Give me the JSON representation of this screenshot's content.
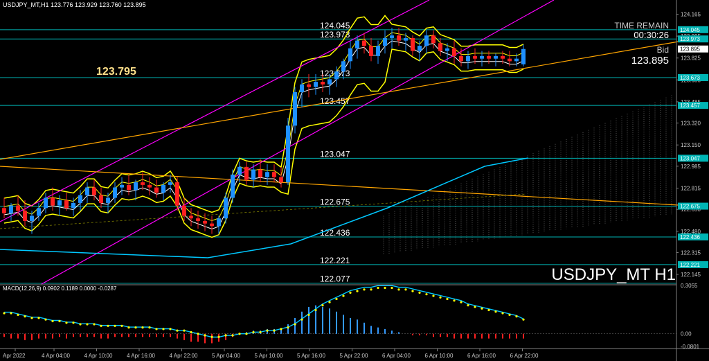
{
  "header": {
    "symbol_line": "USDJPY_MT,H1  123.776 123.929 123.760 123.895",
    "macd_line": "MACD(12,26,9) 0.0902 0.1189 0.0000 -0.0287"
  },
  "info": {
    "big_price": "123.795",
    "time_remain_label": "TIME REMAIN",
    "time_remain_value": "00:30:26",
    "bid_label": "Bid",
    "bid_value": "123.895",
    "watermark": "USDJPY_MT H1"
  },
  "level_labels": [
    "124.045",
    "123.973",
    "123.673",
    "123.457",
    "123.047",
    "122.675",
    "122.436",
    "122.221",
    "122.077"
  ],
  "price_axis": {
    "ticks": [
      "124.165",
      "123.995",
      "123.825",
      "123.655",
      "123.485",
      "123.320",
      "123.150",
      "122.985",
      "122.815",
      "122.650",
      "122.480",
      "122.315",
      "122.145"
    ],
    "highlights": [
      {
        "value": "124.045",
        "type": "level"
      },
      {
        "value": "123.973",
        "type": "level"
      },
      {
        "value": "123.895",
        "type": "bid"
      },
      {
        "value": "123.673",
        "type": "level"
      },
      {
        "value": "123.457",
        "type": "level"
      },
      {
        "value": "123.047",
        "type": "level"
      },
      {
        "value": "122.675",
        "type": "level"
      },
      {
        "value": "122.436",
        "type": "level"
      },
      {
        "value": "122.221",
        "type": "level"
      }
    ]
  },
  "macd_axis": {
    "ticks": [
      "0.3055",
      "0.00",
      "-0.0801"
    ]
  },
  "time_axis": [
    "Apr 2022",
    "4 Apr 04:00",
    "4 Apr 10:00",
    "4 Apr 16:00",
    "4 Apr 22:00",
    "5 Apr 04:00",
    "5 Apr 10:00",
    "5 Apr 16:00",
    "5 Apr 22:00",
    "6 Apr 04:00",
    "6 Apr 10:00",
    "6 Apr 16:00",
    "6 Apr 22:00"
  ],
  "colors": {
    "background": "#000000",
    "bull": "#1e90ff",
    "bear": "#ff2020",
    "level_line": "#00b4b4",
    "band": "#ffff00",
    "channel": "#ff00ff",
    "trend": "#ffa500",
    "ma": "#00c8ff",
    "macd_signal": "#ffff00"
  },
  "chart_data": {
    "type": "candlestick",
    "candles": [
      [
        122.66,
        122.74,
        122.58,
        122.62
      ],
      [
        122.62,
        122.7,
        122.56,
        122.68
      ],
      [
        122.68,
        122.76,
        122.6,
        122.64
      ],
      [
        122.64,
        122.72,
        122.52,
        122.56
      ],
      [
        122.56,
        122.64,
        122.46,
        122.6
      ],
      [
        122.6,
        122.7,
        122.56,
        122.66
      ],
      [
        122.66,
        122.78,
        122.62,
        122.74
      ],
      [
        122.74,
        122.82,
        122.64,
        122.68
      ],
      [
        122.68,
        122.76,
        122.6,
        122.72
      ],
      [
        122.72,
        122.78,
        122.64,
        122.66
      ],
      [
        122.66,
        122.74,
        122.6,
        122.7
      ],
      [
        122.7,
        122.8,
        122.64,
        122.76
      ],
      [
        122.76,
        122.86,
        122.7,
        122.82
      ],
      [
        122.82,
        122.88,
        122.72,
        122.76
      ],
      [
        122.76,
        122.82,
        122.66,
        122.7
      ],
      [
        122.7,
        122.78,
        122.62,
        122.74
      ],
      [
        122.74,
        122.86,
        122.7,
        122.82
      ],
      [
        122.82,
        122.9,
        122.76,
        122.84
      ],
      [
        122.84,
        122.92,
        122.76,
        122.8
      ],
      [
        122.8,
        122.88,
        122.72,
        122.86
      ],
      [
        122.86,
        122.94,
        122.8,
        122.84
      ],
      [
        122.84,
        122.9,
        122.76,
        122.82
      ],
      [
        122.82,
        122.88,
        122.74,
        122.78
      ],
      [
        122.78,
        122.86,
        122.72,
        122.84
      ],
      [
        122.84,
        122.92,
        122.78,
        122.86
      ],
      [
        122.86,
        122.9,
        122.64,
        122.68
      ],
      [
        122.68,
        122.74,
        122.56,
        122.6
      ],
      [
        122.6,
        122.66,
        122.52,
        122.58
      ],
      [
        122.58,
        122.64,
        122.5,
        122.56
      ],
      [
        122.56,
        122.62,
        122.48,
        122.54
      ],
      [
        122.54,
        122.6,
        122.46,
        122.52
      ],
      [
        122.52,
        122.6,
        122.46,
        122.58
      ],
      [
        122.58,
        122.78,
        122.54,
        122.74
      ],
      [
        122.74,
        122.96,
        122.7,
        122.92
      ],
      [
        122.92,
        123.02,
        122.86,
        122.98
      ],
      [
        122.98,
        123.02,
        122.84,
        122.88
      ],
      [
        122.88,
        123.0,
        122.82,
        122.96
      ],
      [
        122.96,
        123.04,
        122.86,
        122.9
      ],
      [
        122.9,
        123.0,
        122.84,
        122.94
      ],
      [
        122.94,
        123.0,
        122.86,
        122.9
      ],
      [
        122.9,
        122.98,
        122.82,
        122.86
      ],
      [
        122.86,
        123.36,
        122.84,
        123.3
      ],
      [
        123.3,
        123.6,
        123.24,
        123.56
      ],
      [
        123.56,
        123.66,
        123.44,
        123.62
      ],
      [
        123.62,
        123.7,
        123.52,
        123.6
      ],
      [
        123.6,
        123.7,
        123.54,
        123.64
      ],
      [
        123.64,
        123.7,
        123.56,
        123.62
      ],
      [
        123.62,
        123.7,
        123.54,
        123.66
      ],
      [
        123.66,
        123.76,
        123.6,
        123.72
      ],
      [
        123.72,
        123.82,
        123.66,
        123.8
      ],
      [
        123.8,
        123.96,
        123.74,
        123.9
      ],
      [
        123.9,
        124.0,
        123.82,
        123.96
      ],
      [
        123.96,
        124.02,
        123.86,
        123.92
      ],
      [
        123.92,
        123.98,
        123.8,
        123.84
      ],
      [
        123.84,
        123.96,
        123.78,
        123.92
      ],
      [
        123.92,
        124.04,
        123.86,
        123.98
      ],
      [
        123.98,
        124.06,
        123.9,
        124.0
      ],
      [
        124.0,
        124.06,
        123.92,
        123.96
      ],
      [
        123.96,
        124.02,
        123.88,
        123.98
      ],
      [
        123.98,
        124.0,
        123.84,
        123.88
      ],
      [
        123.88,
        123.96,
        123.8,
        123.92
      ],
      [
        123.92,
        124.04,
        123.86,
        124.0
      ],
      [
        124.0,
        124.04,
        123.9,
        123.94
      ],
      [
        123.94,
        123.98,
        123.84,
        123.88
      ],
      [
        123.88,
        123.94,
        123.8,
        123.9
      ],
      [
        123.9,
        123.96,
        123.78,
        123.84
      ],
      [
        123.84,
        123.9,
        123.76,
        123.8
      ],
      [
        123.8,
        123.88,
        123.74,
        123.84
      ],
      [
        123.84,
        123.9,
        123.78,
        123.82
      ],
      [
        123.82,
        123.88,
        123.76,
        123.84
      ],
      [
        123.84,
        123.88,
        123.78,
        123.82
      ],
      [
        123.82,
        123.86,
        123.76,
        123.84
      ],
      [
        123.84,
        123.88,
        123.78,
        123.82
      ],
      [
        123.82,
        123.88,
        123.76,
        123.8
      ],
      [
        123.8,
        123.86,
        123.76,
        123.82
      ],
      [
        123.776,
        123.929,
        123.76,
        123.895
      ]
    ],
    "macd_histogram": [
      -0.02,
      -0.03,
      -0.03,
      -0.04,
      -0.04,
      -0.03,
      -0.03,
      -0.03,
      -0.02,
      -0.03,
      -0.02,
      -0.02,
      -0.02,
      -0.02,
      -0.03,
      -0.03,
      -0.02,
      -0.02,
      -0.02,
      -0.02,
      -0.02,
      -0.02,
      -0.02,
      -0.02,
      -0.02,
      -0.03,
      -0.04,
      -0.05,
      -0.05,
      -0.06,
      -0.06,
      -0.05,
      -0.04,
      -0.02,
      0.0,
      0.01,
      0.02,
      0.02,
      0.03,
      0.03,
      0.03,
      0.06,
      0.1,
      0.14,
      0.17,
      0.18,
      0.17,
      0.16,
      0.14,
      0.12,
      0.1,
      0.09,
      0.07,
      0.05,
      0.04,
      0.03,
      0.02,
      0.01,
      0.0,
      -0.01,
      -0.01,
      -0.01,
      -0.02,
      -0.02,
      -0.02,
      -0.03,
      -0.03,
      -0.03,
      -0.03,
      -0.03,
      -0.03,
      -0.03,
      -0.03,
      -0.03,
      -0.03,
      -0.03
    ],
    "macd_signal": [
      0.13,
      0.13,
      0.12,
      0.11,
      0.1,
      0.1,
      0.09,
      0.08,
      0.08,
      0.07,
      0.07,
      0.06,
      0.06,
      0.06,
      0.05,
      0.05,
      0.05,
      0.05,
      0.04,
      0.04,
      0.04,
      0.04,
      0.03,
      0.03,
      0.03,
      0.02,
      0.02,
      0.01,
      0.0,
      -0.01,
      -0.02,
      -0.02,
      -0.01,
      -0.01,
      0.0,
      0.0,
      0.01,
      0.01,
      0.02,
      0.02,
      0.03,
      0.04,
      0.06,
      0.09,
      0.12,
      0.15,
      0.18,
      0.2,
      0.22,
      0.24,
      0.26,
      0.27,
      0.28,
      0.28,
      0.29,
      0.29,
      0.29,
      0.28,
      0.28,
      0.27,
      0.26,
      0.25,
      0.24,
      0.23,
      0.22,
      0.21,
      0.2,
      0.18,
      0.17,
      0.16,
      0.15,
      0.14,
      0.13,
      0.12,
      0.11,
      0.09
    ],
    "price_range": [
      122.07,
      124.2
    ],
    "macd_range": [
      -0.0801,
      0.3055
    ]
  }
}
